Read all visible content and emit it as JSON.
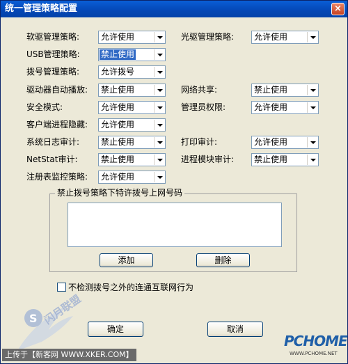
{
  "window": {
    "title": "统一管理策略配置",
    "close_glyph": "×"
  },
  "fields": [
    {
      "label": "软驱管理策略:",
      "value": "允许使用"
    },
    {
      "label": "光驱管理策略:",
      "value": "允许使用"
    },
    {
      "label": "USB管理策略:",
      "value": "禁止使用"
    },
    {
      "label": "拨号管理策略:",
      "value": "允许拨号"
    },
    {
      "label": "驱动器自动播放:",
      "value": "禁止使用"
    },
    {
      "label": "网络共享:",
      "value": "禁止使用"
    },
    {
      "label": "安全模式:",
      "value": "允许使用"
    },
    {
      "label": "管理员权限:",
      "value": "允许使用"
    },
    {
      "label": "客户端进程隐藏:",
      "value": "允许使用"
    },
    {
      "label": "系统日志审计:",
      "value": "禁止使用"
    },
    {
      "label": "打印审计:",
      "value": "允许使用"
    },
    {
      "label": "NetStat审计:",
      "value": "禁止使用"
    },
    {
      "label": "进程模块审计:",
      "value": "禁止使用"
    },
    {
      "label": "注册表监控策略:",
      "value": "允许使用"
    }
  ],
  "group": {
    "title": "禁止拨号策略下特许拨号上网号码",
    "add_label": "添加",
    "delete_label": "删除"
  },
  "checkbox": {
    "label": "不检测拨号之外的连通互联网行为",
    "checked": false
  },
  "buttons": {
    "ok_label": "确定",
    "cancel_label": "取消"
  },
  "watermarks": {
    "upload_text": "上传于【新客网 WWW.XKER.COM】",
    "pchome_logo": "PCHOME",
    "pchome_url": "WWW.PCHOME.NET",
    "site_logo_text": "闪月联盟"
  }
}
